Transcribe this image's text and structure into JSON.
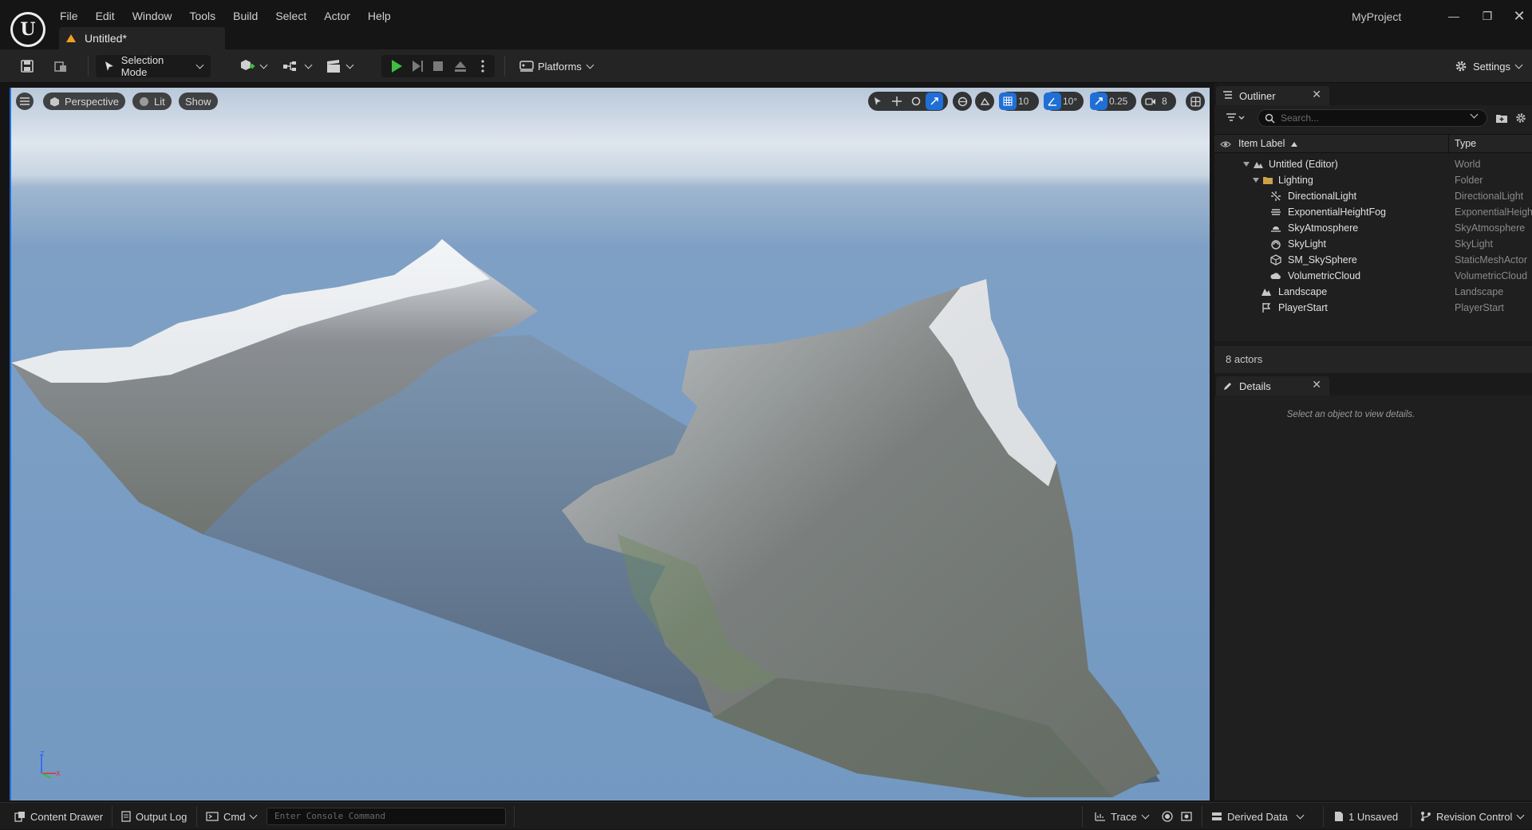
{
  "window": {
    "project_name": "MyProject",
    "document_tab": "Untitled*"
  },
  "menu": [
    "File",
    "Edit",
    "Window",
    "Tools",
    "Build",
    "Select",
    "Actor",
    "Help"
  ],
  "toolbar": {
    "selection_mode": "Selection Mode",
    "platforms": "Platforms",
    "settings": "Settings"
  },
  "viewport": {
    "view_mode": "Perspective",
    "lighting_mode": "Lit",
    "show": "Show",
    "grid_snap": "10",
    "rotation_snap": "10°",
    "scale_snap": "0.25",
    "camera_speed": "8"
  },
  "outliner": {
    "tab_label": "Outliner",
    "search_placeholder": "Search...",
    "col_label": "Item Label",
    "col_type": "Type",
    "items": [
      {
        "label": "Untitled (Editor)",
        "type": "World",
        "icon": "world-icon"
      },
      {
        "label": "Lighting",
        "type": "Folder",
        "icon": "folder-icon"
      },
      {
        "label": "DirectionalLight",
        "type": "DirectionalLight",
        "icon": "directional-light-icon"
      },
      {
        "label": "ExponentialHeightFog",
        "type": "ExponentialHeightFog",
        "icon": "fog-icon"
      },
      {
        "label": "SkyAtmosphere",
        "type": "SkyAtmosphere",
        "icon": "sky-atmosphere-icon"
      },
      {
        "label": "SkyLight",
        "type": "SkyLight",
        "icon": "sky-light-icon"
      },
      {
        "label": "SM_SkySphere",
        "type": "StaticMeshActor",
        "icon": "static-mesh-icon"
      },
      {
        "label": "VolumetricCloud",
        "type": "VolumetricCloud",
        "icon": "cloud-icon"
      },
      {
        "label": "Landscape",
        "type": "Landscape",
        "icon": "landscape-icon"
      },
      {
        "label": "PlayerStart",
        "type": "PlayerStart",
        "icon": "player-start-icon"
      }
    ],
    "actor_count": "8 actors"
  },
  "details": {
    "tab_label": "Details",
    "empty_message": "Select an object to view details."
  },
  "statusbar": {
    "content_drawer": "Content Drawer",
    "output_log": "Output Log",
    "cmd": "Cmd",
    "console_placeholder": "Enter Console Command",
    "trace": "Trace",
    "derived_data": "Derived Data",
    "unsaved": "1 Unsaved",
    "revision_control": "Revision Control"
  },
  "colors": {
    "accent": "#1f6fd6",
    "play_green": "#3fbf3f",
    "tab_warning": "#f0a020"
  }
}
